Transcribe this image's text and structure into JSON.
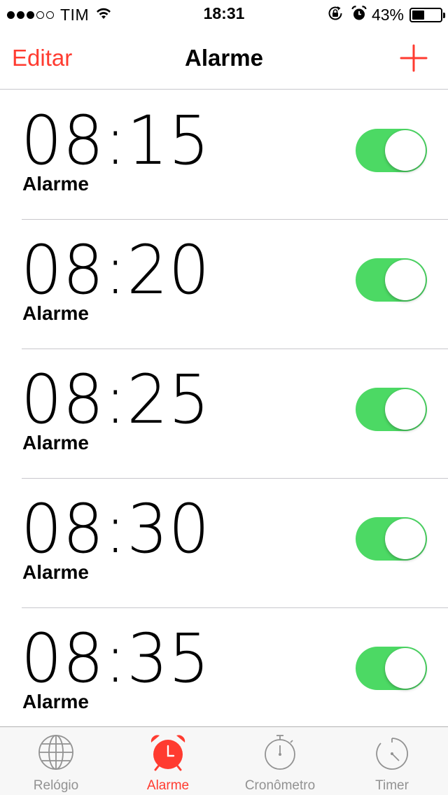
{
  "status_bar": {
    "carrier": "TIM",
    "signal_bars_filled": 3,
    "signal_bars_total": 5,
    "time": "18:31",
    "battery_percent": "43%",
    "battery_level": 0.43,
    "icons": [
      "wifi-icon",
      "rotation-lock-icon",
      "alarm-clock-icon",
      "battery-icon"
    ]
  },
  "nav": {
    "edit_label": "Editar",
    "title": "Alarme",
    "add_icon": "plus-icon",
    "accent_color": "#ff3b30"
  },
  "alarms": [
    {
      "time": "08:15",
      "label": "Alarme",
      "enabled": true
    },
    {
      "time": "08:20",
      "label": "Alarme",
      "enabled": true
    },
    {
      "time": "08:25",
      "label": "Alarme",
      "enabled": true
    },
    {
      "time": "08:30",
      "label": "Alarme",
      "enabled": true
    },
    {
      "time": "08:35",
      "label": "Alarme",
      "enabled": true
    }
  ],
  "toggle_on_color": "#4cd964",
  "tabs": [
    {
      "label": "Relógio",
      "icon": "globe-icon",
      "active": false
    },
    {
      "label": "Alarme",
      "icon": "alarm-clock-icon",
      "active": true
    },
    {
      "label": "Cronômetro",
      "icon": "stopwatch-icon",
      "active": false
    },
    {
      "label": "Timer",
      "icon": "timer-icon",
      "active": false
    }
  ],
  "tab_active_color": "#ff3b30",
  "tab_inactive_color": "#929292"
}
